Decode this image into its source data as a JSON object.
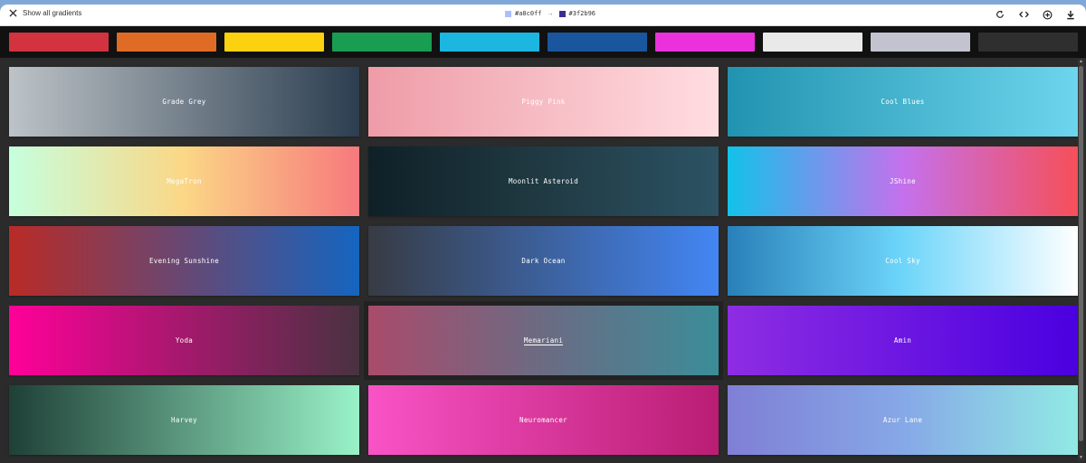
{
  "toolbar": {
    "back_label": "Show all gradients",
    "current": {
      "from_hex": "#a8c0ff",
      "to_hex": "#3f2b96",
      "arrow": "→"
    },
    "actions": [
      "rotate-icon",
      "code-icon",
      "add-circle-icon",
      "download-icon"
    ]
  },
  "filters": [
    {
      "name": "red",
      "color": "#d3323f"
    },
    {
      "name": "orange",
      "color": "#e06b25"
    },
    {
      "name": "yellow",
      "color": "#fcd110"
    },
    {
      "name": "green",
      "color": "#189d52"
    },
    {
      "name": "blue",
      "color": "#1bb7e1"
    },
    {
      "name": "dark-blue",
      "color": "#1a569e"
    },
    {
      "name": "pink",
      "color": "#ea31dc"
    },
    {
      "name": "white",
      "color": "#e9e9e9"
    },
    {
      "name": "grey",
      "color": "#c2c3cf"
    },
    {
      "name": "black",
      "color": "#2f2f2f"
    }
  ],
  "gradients": [
    {
      "name": "Grade Grey",
      "from": "#bdc3c7",
      "to": "#2c3e50"
    },
    {
      "name": "Piggy Pink",
      "from": "#ee9ca7",
      "to": "#ffdde1"
    },
    {
      "name": "Cool Blues",
      "from": "#2193b0",
      "to": "#6dd5ed"
    },
    {
      "name": "MegaTron",
      "from": "#c6ffdd",
      "via": "#fbd786",
      "to": "#f7797d"
    },
    {
      "name": "Moonlit Asteroid",
      "from": "#0f2027",
      "via": "#203a43",
      "to": "#2c5364"
    },
    {
      "name": "JShine",
      "from": "#12c2e9",
      "via": "#c471ed",
      "to": "#f64f59"
    },
    {
      "name": "Evening Sunshine",
      "from": "#b92b27",
      "to": "#1565c0"
    },
    {
      "name": "Dark Ocean",
      "from": "#373b44",
      "to": "#4286f4"
    },
    {
      "name": "Cool Sky",
      "from": "#2980b9",
      "via": "#6dd5fa",
      "to": "#ffffff"
    },
    {
      "name": "Yoda",
      "from": "#ff0099",
      "to": "#493240"
    },
    {
      "name": "Memariani",
      "from": "#aa4b6b",
      "via": "#6b6b83",
      "to": "#3b8d99",
      "selected": true
    },
    {
      "name": "Amin",
      "from": "#8e2de2",
      "to": "#4a00e0"
    },
    {
      "name": "Harvey",
      "from": "#1f4037",
      "to": "#99f2c8"
    },
    {
      "name": "Neuromancer",
      "from": "#f953c6",
      "to": "#b91d73"
    },
    {
      "name": "Azur Lane",
      "from": "#7f7fd5",
      "via": "#86a8e7",
      "to": "#91eae4"
    }
  ]
}
